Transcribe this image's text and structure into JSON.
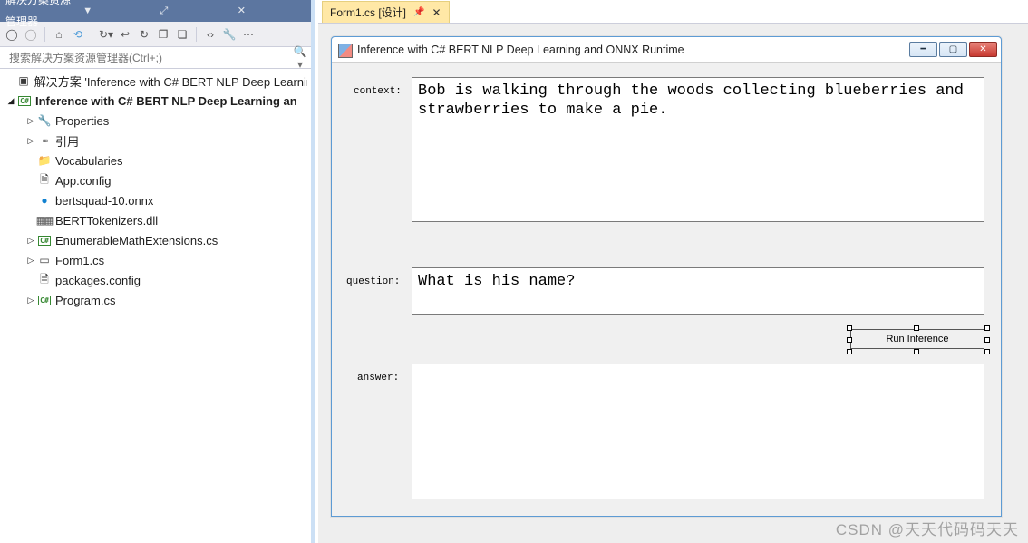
{
  "explorer": {
    "title": "解决方案资源管理器",
    "search_placeholder": "搜索解决方案资源管理器(Ctrl+;)",
    "tree": {
      "solution": "解决方案 'Inference with C# BERT NLP Deep Learning",
      "project": "Inference with C# BERT NLP Deep Learning an",
      "items": {
        "properties": "Properties",
        "references": "引用",
        "vocabularies": "Vocabularies",
        "appconfig": "App.config",
        "onnx": "bertsquad-10.onnx",
        "dll": "BERTTokenizers.dll",
        "mathext": "EnumerableMathExtensions.cs",
        "form1": "Form1.cs",
        "packages": "packages.config",
        "program": "Program.cs"
      }
    }
  },
  "tab": {
    "label": "Form1.cs [设计]"
  },
  "winform": {
    "title": "Inference with C# BERT NLP Deep Learning and ONNX Runtime",
    "labels": {
      "context": "context:",
      "question": "question:",
      "answer": "answer:"
    },
    "context": "Bob is walking through the woods collecting blueberries and strawberries to make a pie.",
    "question": "What is his name?",
    "answer": "",
    "run": "Run Inference"
  },
  "watermark": "CSDN @天天代码码天天"
}
